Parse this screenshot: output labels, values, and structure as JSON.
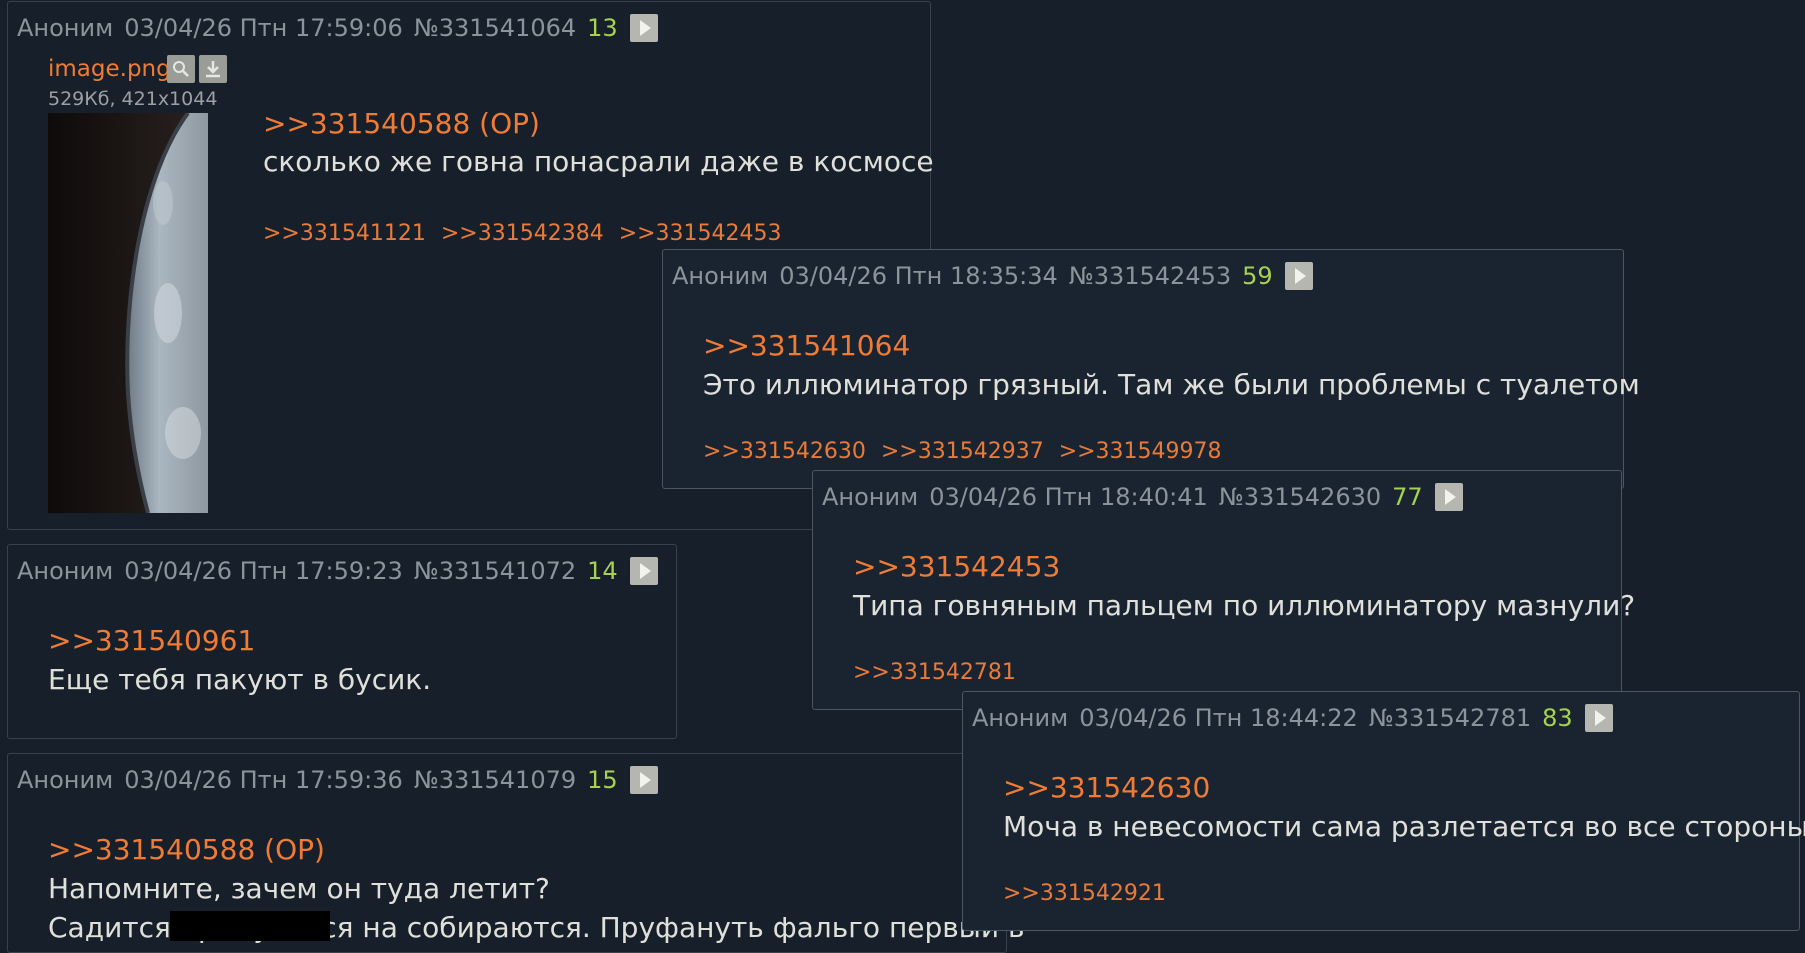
{
  "posts": {
    "p1": {
      "author": "Аноним",
      "date": "03/04/26 Птн 17:59:06",
      "num": "№331541064",
      "count": "13",
      "file": {
        "name": "image.png",
        "meta": "529Кб, 421x1044"
      },
      "reply": ">>331540588 (OP)",
      "text": "сколько же говна понасрали даже в космосе",
      "backlinks": [
        ">>331541121",
        ">>331542384",
        ">>331542453"
      ]
    },
    "p2": {
      "author": "Аноним",
      "date": "03/04/26 Птн 18:35:34",
      "num": "№331542453",
      "count": "59",
      "reply": ">>331541064",
      "text": "Это иллюминатор грязный. Там же были проблемы с туалетом",
      "backlinks": [
        ">>331542630",
        ">>331542937",
        ">>331549978"
      ]
    },
    "p3": {
      "author": "Аноним",
      "date": "03/04/26 Птн 17:59:23",
      "num": "№331541072",
      "count": "14",
      "reply": ">>331540961",
      "text": "Еще тебя пакуют в бусик."
    },
    "p4": {
      "author": "Аноним",
      "date": "03/04/26 Птн 18:40:41",
      "num": "№331542630",
      "count": "77",
      "reply": ">>331542453",
      "text": "Типа говняным пальцем по иллюминатору мазнули?",
      "backlinks": [
        ">>331542781"
      ]
    },
    "p5": {
      "author": "Аноним",
      "date": "03/04/26 Птн 17:59:36",
      "num": "№331541079",
      "count": "15",
      "reply": ">>331540588 (OP)",
      "text": "Напомните, зачем он туда летит?",
      "text2": "Садится придуиятся на собираются. Пруфануть фальго первый в"
    },
    "p6": {
      "author": "Аноним",
      "date": "03/04/26 Птн 18:44:22",
      "num": "№331542781",
      "count": "83",
      "reply": ">>331542630",
      "text": "Моча в невесомости сама разлетается во все стороны",
      "backlinks": [
        ">>331542921"
      ]
    }
  },
  "colors": {
    "background": "#17202a",
    "link": "#f07b35",
    "count": "#a7d251",
    "meta": "#8b949a",
    "text": "#e0e0da"
  },
  "icons": [
    "play-icon",
    "search-icon",
    "download-icon"
  ]
}
